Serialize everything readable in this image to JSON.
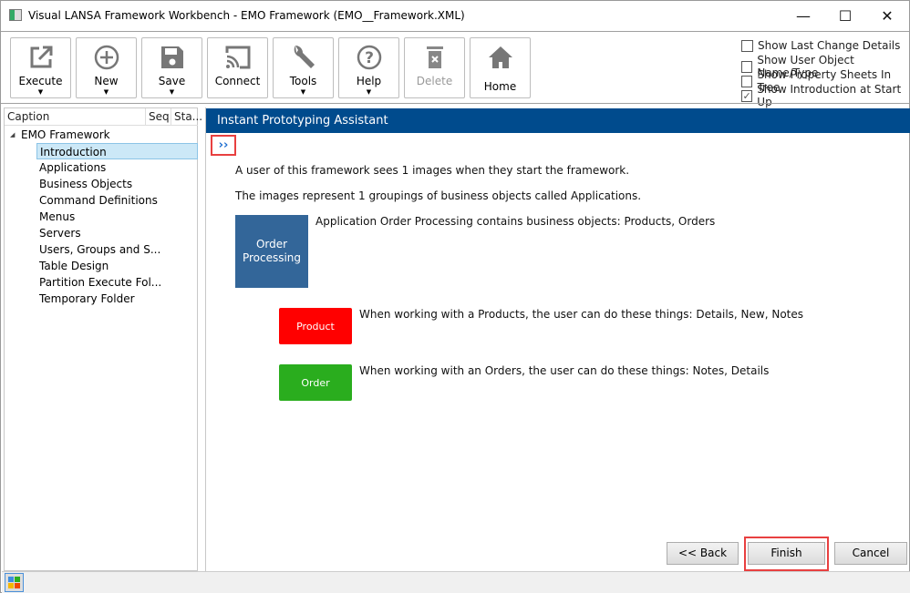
{
  "window": {
    "title": "Visual LANSA Framework Workbench - EMO Framework (EMO__Framework.XML)",
    "minimize": "—",
    "maximize": "☐",
    "close": "✕"
  },
  "toolbar": {
    "buttons": [
      {
        "label": "Execute",
        "icon": "external-link-icon",
        "dropdown": true
      },
      {
        "label": "New",
        "icon": "plus-circle-icon",
        "dropdown": true
      },
      {
        "label": "Save",
        "icon": "floppy-icon",
        "dropdown": true
      },
      {
        "label": "Connect",
        "icon": "cast-icon",
        "dropdown": false
      },
      {
        "label": "Tools",
        "icon": "wrench-icon",
        "dropdown": true
      },
      {
        "label": "Help",
        "icon": "question-icon",
        "dropdown": true
      },
      {
        "label": "Delete",
        "icon": "trash-icon",
        "dropdown": false,
        "disabled": true
      },
      {
        "label": "Home",
        "icon": "home-icon",
        "dropdown": false
      }
    ],
    "arrow": "▼"
  },
  "options": [
    {
      "label": "Show Last Change Details",
      "checked": false
    },
    {
      "label": "Show User Object Name/Type",
      "checked": false
    },
    {
      "label": "Show Property Sheets In Tree",
      "checked": false
    },
    {
      "label": "Show Introduction at Start Up",
      "checked": true,
      "mark": "✓"
    }
  ],
  "tree": {
    "columns": [
      "Caption",
      "Seq",
      "Sta..."
    ],
    "root": "EMO Framework",
    "expander": "◢",
    "items": [
      "Introduction",
      "Applications",
      "Business Objects",
      "Command Definitions",
      "Menus",
      "Servers",
      "Users, Groups and S...",
      "Table Design",
      "Partition Execute Fol...",
      "Temporary Folder"
    ],
    "selected": "Introduction"
  },
  "main": {
    "title": "Instant Prototyping Assistant",
    "expand": "››",
    "line1": "A user of this framework sees 1 images when they start the framework.",
    "line2": "The images represent 1 groupings of business objects called Applications.",
    "app": {
      "label": "Order Processing",
      "desc": "Application Order Processing contains business objects: Products, Orders",
      "color": "#336699"
    },
    "objects": [
      {
        "label": "Product",
        "desc": "When working with a Products, the user can do these things: Details, New, Notes",
        "color": "#ff0000"
      },
      {
        "label": "Order",
        "desc": "When working with an Orders, the user can do these things: Notes, Details",
        "color": "#2aad1e"
      }
    ]
  },
  "buttons": {
    "back": "<< Back",
    "finish": "Finish",
    "cancel": "Cancel"
  },
  "colors": {
    "header": "#004b8d",
    "highlight": "#e84040"
  }
}
